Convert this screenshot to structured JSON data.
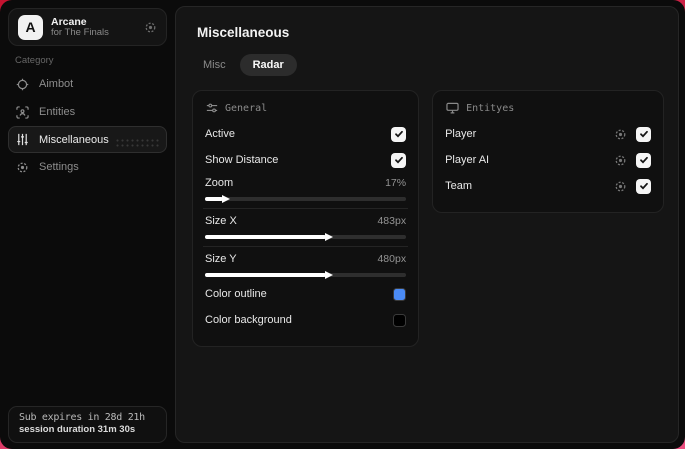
{
  "backdrop": {
    "accent_top": "#c41330",
    "accent_bottom": "#ea4f80"
  },
  "sidebar": {
    "brand": {
      "logo_letter": "A",
      "title": "Arcane",
      "subtitle": "for The Finals",
      "gear_icon": "gear-icon"
    },
    "category_label": "Category",
    "items": [
      {
        "label": "Aimbot",
        "icon": "crosshair-icon",
        "active": false
      },
      {
        "label": "Entities",
        "icon": "scan-icon",
        "active": false
      },
      {
        "label": "Miscellaneous",
        "icon": "sliders-vertical-icon",
        "active": true
      },
      {
        "label": "Settings",
        "icon": "gear-icon",
        "active": false
      }
    ],
    "footer": {
      "line1": "Sub expires in 28d 21h",
      "line2": "session duration 31m 30s"
    }
  },
  "main": {
    "title": "Miscellaneous",
    "tabs": [
      {
        "label": "Misc",
        "active": false
      },
      {
        "label": "Radar",
        "active": true
      }
    ],
    "general_card": {
      "header": "General",
      "header_icon": "sliders-horizontal-icon",
      "toggles": [
        {
          "label": "Active",
          "checked": true
        },
        {
          "label": "Show Distance",
          "checked": true
        }
      ],
      "sliders": [
        {
          "label": "Zoom",
          "value": "17%",
          "fill_percent": 9
        },
        {
          "label": "Size X",
          "value": "483px",
          "fill_percent": 60
        },
        {
          "label": "Size Y",
          "value": "480px",
          "fill_percent": 60
        }
      ],
      "colors": [
        {
          "label": "Color outline",
          "swatch": "#4b8bf5"
        },
        {
          "label": "Color background",
          "swatch": "#000000"
        }
      ]
    },
    "entities_card": {
      "header": "Entityes",
      "header_icon": "monitor-icon",
      "rows": [
        {
          "label": "Player",
          "checked": true
        },
        {
          "label": "Player AI",
          "checked": true
        },
        {
          "label": "Team",
          "checked": true
        }
      ]
    }
  }
}
